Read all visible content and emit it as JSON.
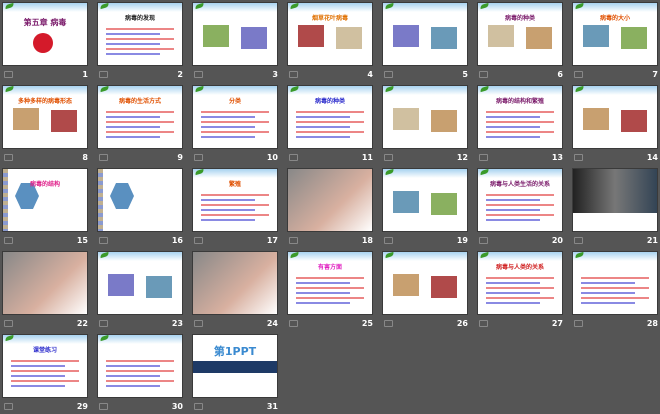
{
  "slides": [
    {
      "number": "1",
      "title": "第五章 病毒",
      "title_color": "#7a1a6a",
      "kind": "title"
    },
    {
      "number": "2",
      "title": "病毒的发现",
      "title_color": "#222222",
      "kind": "text"
    },
    {
      "number": "3",
      "title": "",
      "title_color": "#222222",
      "kind": "leaves"
    },
    {
      "number": "4",
      "title": "烟草花叶病毒",
      "title_color": "#e07000",
      "kind": "imgtext"
    },
    {
      "number": "5",
      "title": "",
      "title_color": "#222222",
      "kind": "photos"
    },
    {
      "number": "6",
      "title": "病毒的种类",
      "title_color": "#7a1a6a",
      "kind": "imgtext"
    },
    {
      "number": "7",
      "title": "病毒的大小",
      "title_color": "#e05000",
      "kind": "imgtext"
    },
    {
      "number": "8",
      "title": "多种多样的病毒形态",
      "title_color": "#e05000",
      "kind": "photos"
    },
    {
      "number": "9",
      "title": "病毒的生活方式",
      "title_color": "#e05000",
      "kind": "text"
    },
    {
      "number": "10",
      "title": "分类",
      "title_color": "#e05000",
      "kind": "text"
    },
    {
      "number": "11",
      "title": "病毒的种类",
      "title_color": "#2a2acc",
      "kind": "table"
    },
    {
      "number": "12",
      "title": "",
      "title_color": "#222222",
      "kind": "photos"
    },
    {
      "number": "13",
      "title": "病毒的结构和繁殖",
      "title_color": "#7a1a6a",
      "kind": "text"
    },
    {
      "number": "14",
      "title": "",
      "title_color": "#222222",
      "kind": "photos"
    },
    {
      "number": "15",
      "title": "病毒的结构",
      "title_color": "#e0208a",
      "kind": "diagram"
    },
    {
      "number": "16",
      "title": "",
      "title_color": "#222222",
      "kind": "diagram"
    },
    {
      "number": "17",
      "title": "繁殖",
      "title_color": "#e05000",
      "kind": "text"
    },
    {
      "number": "18",
      "title": "",
      "title_color": "#222222",
      "kind": "full"
    },
    {
      "number": "19",
      "title": "",
      "title_color": "#222222",
      "kind": "photos"
    },
    {
      "number": "20",
      "title": "病毒与人类生活的关系",
      "title_color": "#7a1a6a",
      "kind": "text"
    },
    {
      "number": "21",
      "title": "",
      "title_color": "#222222",
      "kind": "dark"
    },
    {
      "number": "22",
      "title": "",
      "title_color": "#222222",
      "kind": "full"
    },
    {
      "number": "23",
      "title": "",
      "title_color": "#222222",
      "kind": "photos"
    },
    {
      "number": "24",
      "title": "",
      "title_color": "#222222",
      "kind": "full"
    },
    {
      "number": "25",
      "title": "有害方面",
      "title_color": "#e020c0",
      "kind": "text"
    },
    {
      "number": "26",
      "title": "",
      "title_color": "#222222",
      "kind": "photos"
    },
    {
      "number": "27",
      "title": "病毒与人类的关系",
      "title_color": "#d02020",
      "kind": "text"
    },
    {
      "number": "28",
      "title": "",
      "title_color": "#d02020",
      "kind": "text"
    },
    {
      "number": "29",
      "title": "课堂练习",
      "title_color": "#2a2acc",
      "kind": "text"
    },
    {
      "number": "30",
      "title": "",
      "title_color": "#222222",
      "kind": "text"
    },
    {
      "number": "31",
      "title": "第1PPT",
      "title_color": "#3a8ad0",
      "kind": "brand"
    }
  ]
}
